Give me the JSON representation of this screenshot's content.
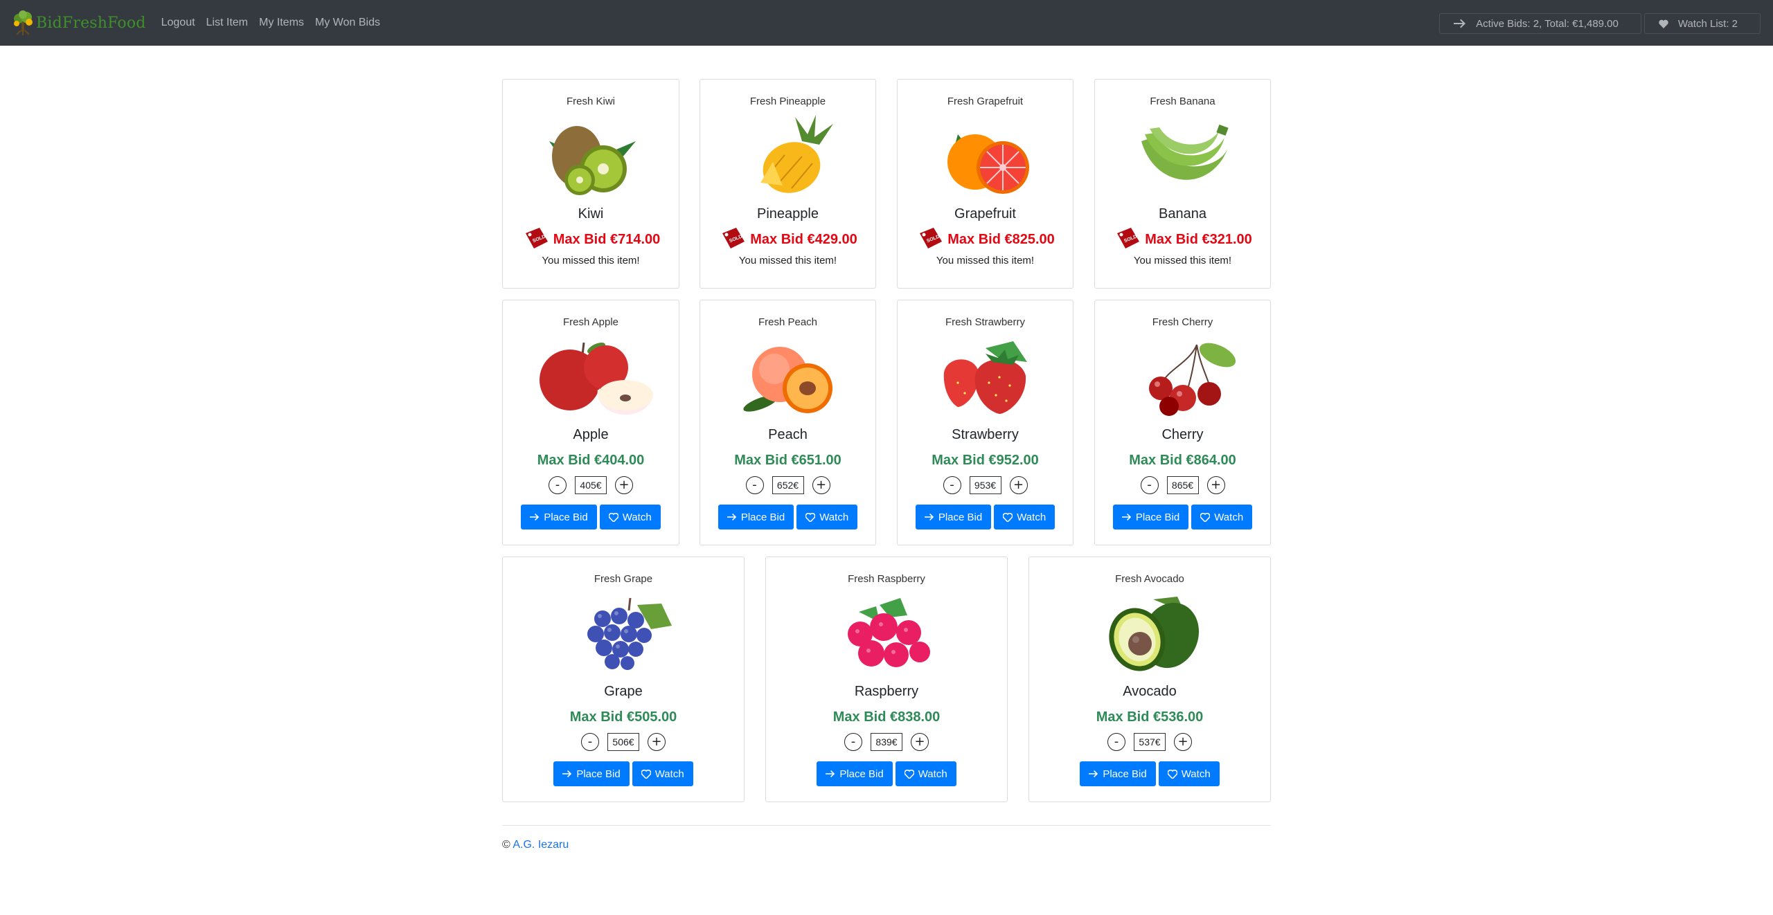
{
  "nav": {
    "brand": "BidFreshFood",
    "links": [
      "Logout",
      "List Item",
      "My Items",
      "My Won Bids"
    ],
    "active_bids": "Active Bids: 2, Total: €1,489.00",
    "watch_list": "Watch List: 2"
  },
  "labels": {
    "place_bid": "Place Bid",
    "watch": "Watch",
    "missed": "You missed this item!",
    "minus": "-",
    "plus": "+"
  },
  "sold_items": [
    {
      "header": "Fresh Kiwi",
      "name": "Kiwi",
      "price": "Max Bid €714.00",
      "icon": "kiwi-image"
    },
    {
      "header": "Fresh Pineapple",
      "name": "Pineapple",
      "price": "Max Bid €429.00",
      "icon": "pineapple-image"
    },
    {
      "header": "Fresh Grapefruit",
      "name": "Grapefruit",
      "price": "Max Bid €825.00",
      "icon": "grapefruit-image"
    },
    {
      "header": "Fresh Banana",
      "name": "Banana",
      "price": "Max Bid €321.00",
      "icon": "banana-image"
    }
  ],
  "open_items": [
    {
      "header": "Fresh Apple",
      "name": "Apple",
      "price": "Max Bid €404.00",
      "bid": "405€",
      "icon": "apple-image"
    },
    {
      "header": "Fresh Peach",
      "name": "Peach",
      "price": "Max Bid €651.00",
      "bid": "652€",
      "icon": "peach-image"
    },
    {
      "header": "Fresh Strawberry",
      "name": "Strawberry",
      "price": "Max Bid €952.00",
      "bid": "953€",
      "icon": "strawberry-image"
    },
    {
      "header": "Fresh Cherry",
      "name": "Cherry",
      "price": "Max Bid €864.00",
      "bid": "865€",
      "icon": "cherry-image"
    },
    {
      "header": "Fresh Grape",
      "name": "Grape",
      "price": "Max Bid €505.00",
      "bid": "506€",
      "icon": "grape-image"
    },
    {
      "header": "Fresh Raspberry",
      "name": "Raspberry",
      "price": "Max Bid €838.00",
      "bid": "839€",
      "icon": "raspberry-image"
    },
    {
      "header": "Fresh Avocado",
      "name": "Avocado",
      "price": "Max Bid €536.00",
      "bid": "537€",
      "icon": "avocado-image"
    }
  ],
  "footer": {
    "copyright": "©",
    "author": "A.G. Iezaru"
  },
  "colors": {
    "navbar": "#343a40",
    "primary": "#007bff",
    "sold": "#e30613",
    "open": "#2e8b57",
    "brand": "#3f8f2b"
  }
}
